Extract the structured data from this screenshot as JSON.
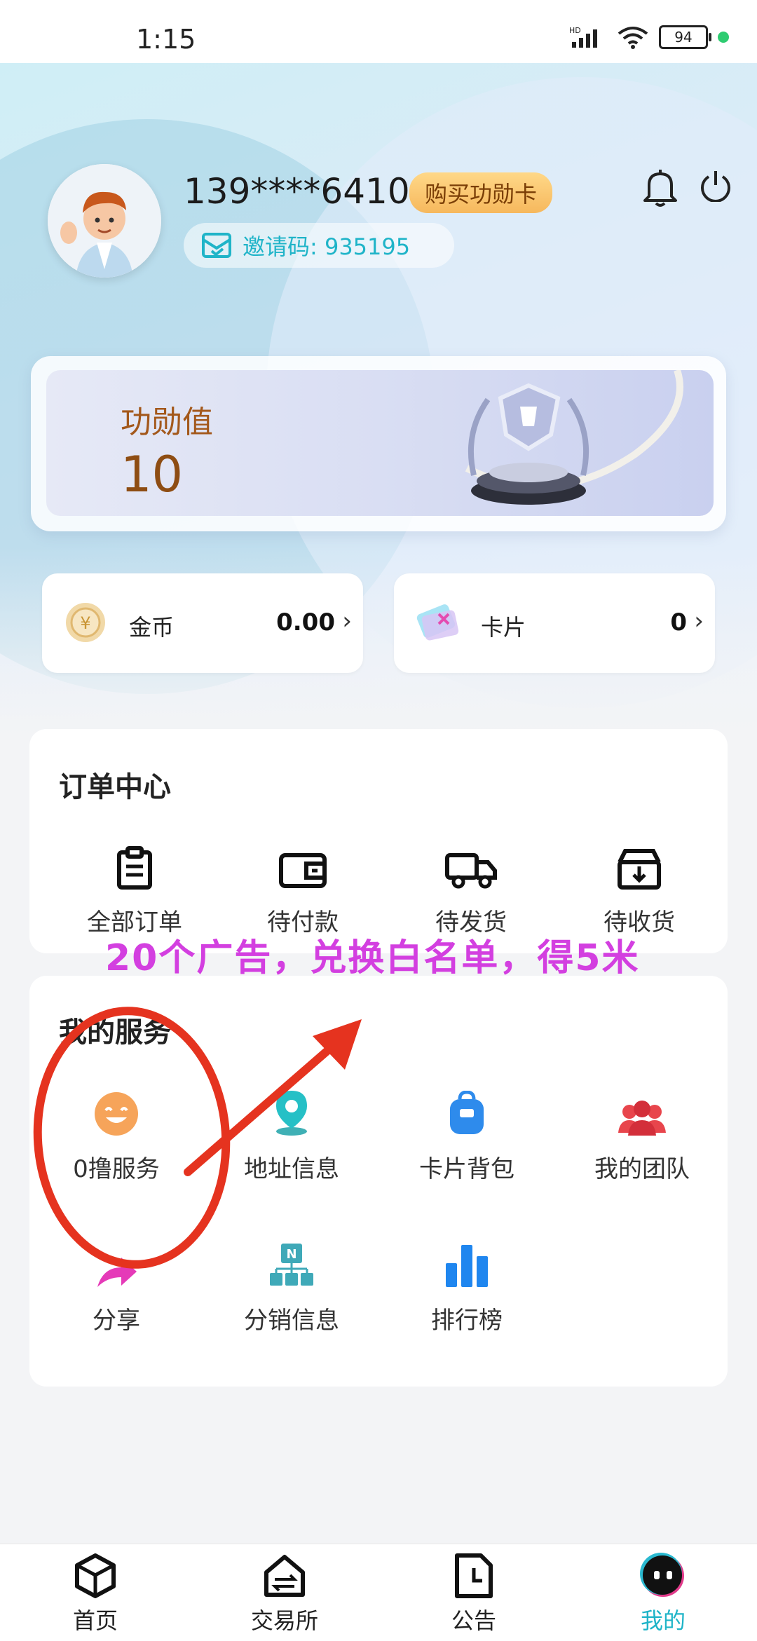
{
  "status_bar": {
    "time": "1:15",
    "battery": "94",
    "icons": [
      "hd-signal-icon",
      "wifi-icon",
      "battery-icon",
      "green-dot-icon"
    ]
  },
  "profile": {
    "phone": "139****6410",
    "buy_card_label": "购买功勋卡",
    "invite_code": "邀请码: 935195"
  },
  "merit": {
    "label": "功勋值",
    "value": "10"
  },
  "wallet": {
    "coins_label": "金币",
    "coins_value": "0.00",
    "cards_label": "卡片",
    "cards_value": "0"
  },
  "orders": {
    "title": "订单中心",
    "items": [
      {
        "label": "全部订单",
        "icon": "clipboard-icon"
      },
      {
        "label": "待付款",
        "icon": "wallet-icon"
      },
      {
        "label": "待发货",
        "icon": "truck-icon"
      },
      {
        "label": "待收货",
        "icon": "inbox-download-icon"
      }
    ]
  },
  "annotation": {
    "text": "20个广告，兑换白名单，得5米"
  },
  "services": {
    "title": "我的服务",
    "items": [
      {
        "label": "0撸服务",
        "icon": "smile-icon"
      },
      {
        "label": "地址信息",
        "icon": "location-pin-icon"
      },
      {
        "label": "卡片背包",
        "icon": "backpack-icon"
      },
      {
        "label": "我的团队",
        "icon": "team-icon"
      },
      {
        "label": "分享",
        "icon": "share-arrow-icon"
      },
      {
        "label": "分销信息",
        "icon": "hierarchy-icon"
      },
      {
        "label": "排行榜",
        "icon": "bar-chart-icon"
      }
    ]
  },
  "nav": {
    "items": [
      {
        "label": "首页",
        "icon": "cube-icon"
      },
      {
        "label": "交易所",
        "icon": "exchange-house-icon"
      },
      {
        "label": "公告",
        "icon": "notice-clock-icon"
      },
      {
        "label": "我的",
        "icon": "profile-face-icon"
      }
    ],
    "active": "我的"
  },
  "colors": {
    "accent": "#1fb4c8",
    "annotation_text": "#d33fe0",
    "annotation_ink": "#e5331f",
    "merit_text": "#a3581b",
    "buy_card_bg": "#f6b85d"
  }
}
